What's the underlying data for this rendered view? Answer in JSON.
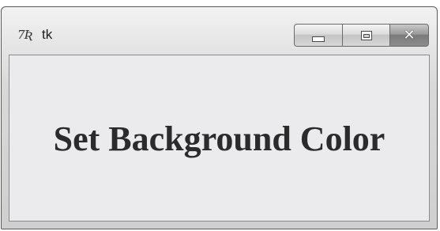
{
  "window": {
    "title": "tk",
    "icon": "tk-feather-icon",
    "icon_glyph": "7Ʀ"
  },
  "controls": {
    "minimize": "minimize-icon",
    "maximize": "maximize-icon",
    "close": "close-icon",
    "close_glyph": "✕"
  },
  "content": {
    "heading": "Set Background Color",
    "background_color": "#ebebed"
  }
}
